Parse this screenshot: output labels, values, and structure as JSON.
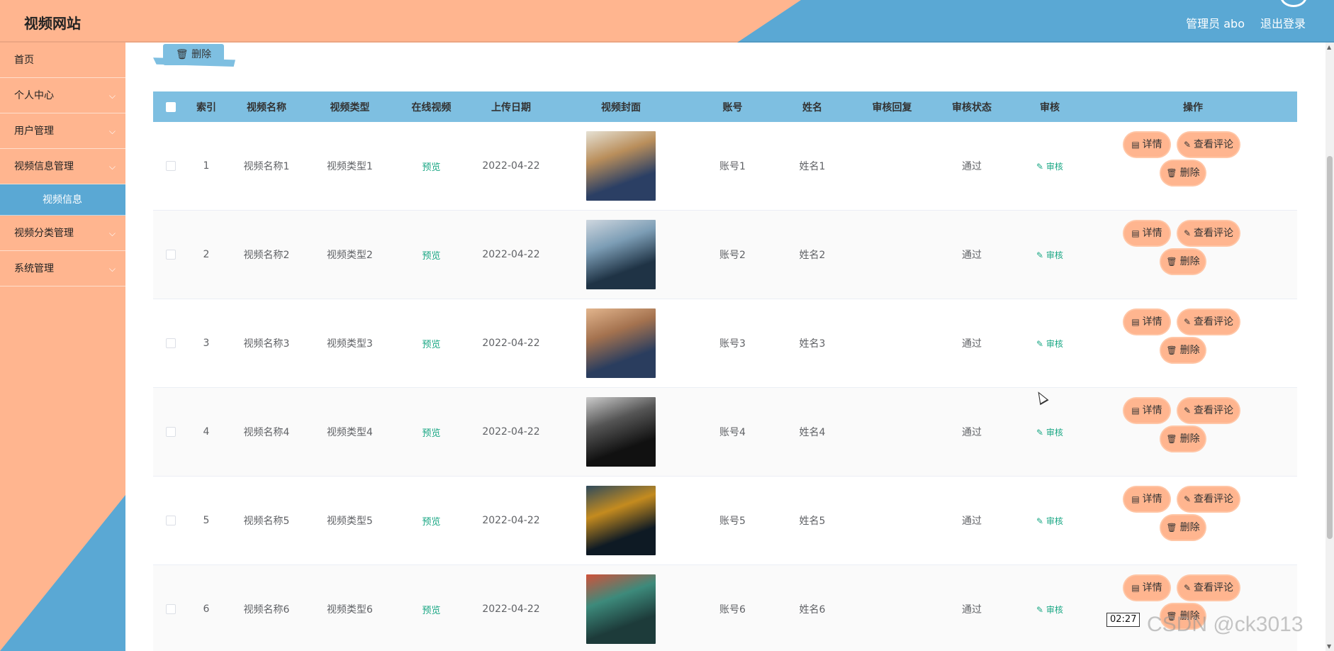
{
  "header": {
    "site_title": "视频网站",
    "admin_label": "管理员 abo",
    "logout_label": "退出登录"
  },
  "sidebar": {
    "items": [
      {
        "label": "首页",
        "chevron": false
      },
      {
        "label": "个人中心",
        "chevron": true
      },
      {
        "label": "用户管理",
        "chevron": true
      },
      {
        "label": "视频信息管理",
        "chevron": true
      },
      {
        "label": "视频信息",
        "sub": true
      },
      {
        "label": "视频分类管理",
        "chevron": true
      },
      {
        "label": "系统管理",
        "chevron": true
      }
    ]
  },
  "toolbar": {
    "delete_label": "删除"
  },
  "table": {
    "headers": [
      "索引",
      "视频名称",
      "视频类型",
      "在线视频",
      "上传日期",
      "视频封面",
      "账号",
      "姓名",
      "审核回复",
      "审核状态",
      "审核",
      "操作"
    ],
    "rows": [
      {
        "index": "1",
        "name": "视频名称1",
        "type": "视频类型1",
        "online": "预览",
        "date": "2022-04-22",
        "account": "账号1",
        "person": "姓名1",
        "reply": "",
        "status": "通过",
        "audit": "审核",
        "cover_colors": [
          "#2b3f64",
          "#b98e5b",
          "#e6e1d4"
        ]
      },
      {
        "index": "2",
        "name": "视频名称2",
        "type": "视频类型2",
        "online": "预览",
        "date": "2022-04-22",
        "account": "账号2",
        "person": "姓名2",
        "reply": "",
        "status": "通过",
        "audit": "审核",
        "cover_colors": [
          "#1f3345",
          "#7c9db5",
          "#cfd7df"
        ]
      },
      {
        "index": "3",
        "name": "视频名称3",
        "type": "视频类型3",
        "online": "预览",
        "date": "2022-04-22",
        "account": "账号3",
        "person": "姓名3",
        "reply": "",
        "status": "通过",
        "audit": "审核",
        "cover_colors": [
          "#2a3d5e",
          "#a4724f",
          "#e2b58d"
        ]
      },
      {
        "index": "4",
        "name": "视频名称4",
        "type": "视频类型4",
        "online": "预览",
        "date": "2022-04-22",
        "account": "账号4",
        "person": "姓名4",
        "reply": "",
        "status": "通过",
        "audit": "审核",
        "cover_colors": [
          "#111111",
          "#555555",
          "#cccccc"
        ]
      },
      {
        "index": "5",
        "name": "视频名称5",
        "type": "视频类型5",
        "online": "预览",
        "date": "2022-04-22",
        "account": "账号5",
        "person": "姓名5",
        "reply": "",
        "status": "通过",
        "audit": "审核",
        "cover_colors": [
          "#0e1a24",
          "#c48b1f",
          "#2e4a5c"
        ]
      },
      {
        "index": "6",
        "name": "视频名称6",
        "type": "视频类型6",
        "online": "预览",
        "date": "2022-04-22",
        "account": "账号6",
        "person": "姓名6",
        "reply": "",
        "status": "通过",
        "audit": "审核",
        "cover_colors": [
          "#1d3b3a",
          "#3d8a7b",
          "#d0523a"
        ]
      }
    ],
    "actions": {
      "detail": "详情",
      "comments": "查看评论",
      "delete": "删除"
    }
  },
  "overlay": {
    "timer": "02:27",
    "watermark": "CSDN @ck3013"
  },
  "colors": {
    "peach": "#ffb58f",
    "blue": "#5aa8d4",
    "table_header": "#7ebfe1",
    "link_green": "#1aa784"
  }
}
